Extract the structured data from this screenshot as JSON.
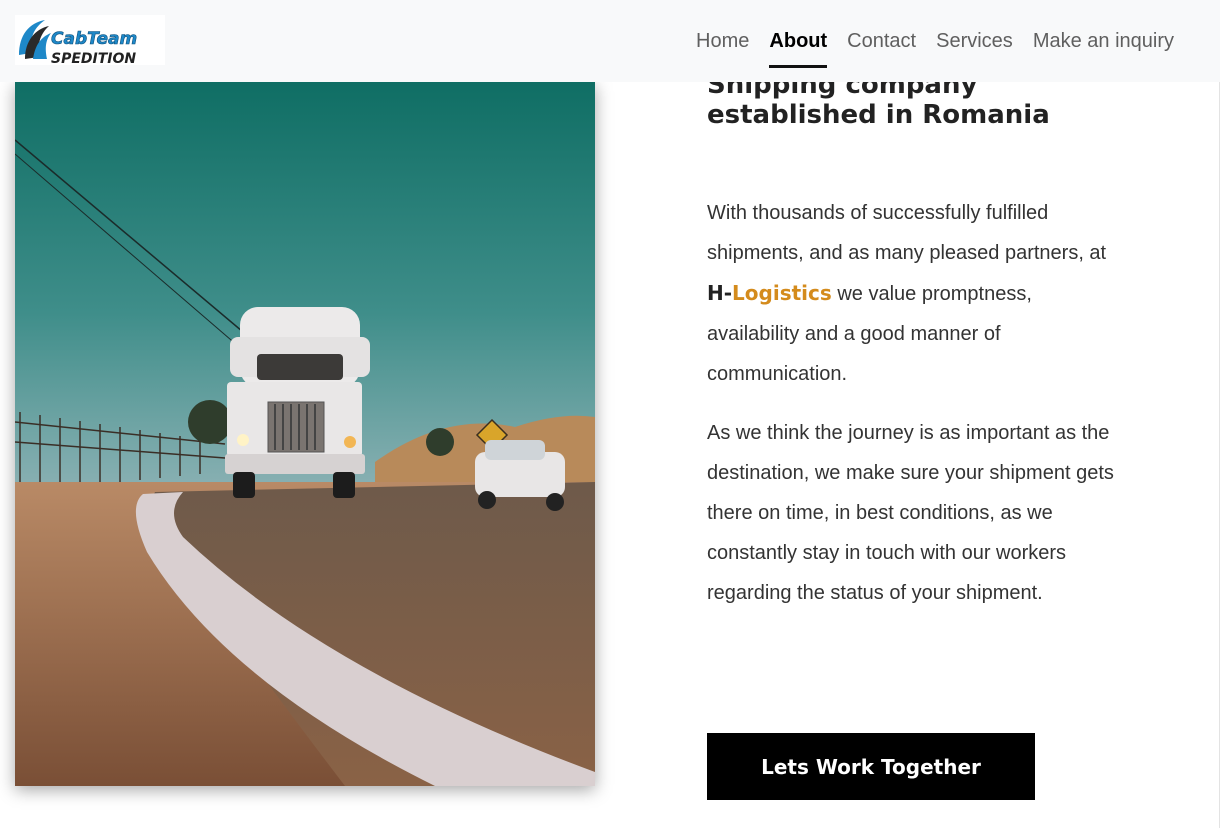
{
  "header": {
    "logo_text_line1": "CabTeam",
    "logo_text_line2": "SPEDITION",
    "nav": [
      {
        "label": "Home",
        "active": false
      },
      {
        "label": "About",
        "active": true
      },
      {
        "label": "Contact",
        "active": false
      },
      {
        "label": "Services",
        "active": false
      },
      {
        "label": "Make an inquiry",
        "active": false
      }
    ]
  },
  "hero": {
    "image_icon": "truck-on-road-photo"
  },
  "about": {
    "heading": "Shipping company established in Romania",
    "para1_before": "With thousands of successfully fulfilled shipments, and as many pleased partners, at ",
    "brand_prefix": "H-",
    "brand_accent": "Logistics",
    "para1_after": " we value promptness, availability and a good manner of communication.",
    "para2": "As we think the journey is as important as the destination, we make sure your shipment gets there on time, in best conditions, as we constantly stay in touch with our workers regarding the status of your shipment.",
    "cta_label": "Lets Work Together"
  },
  "colors": {
    "accent": "#d48b1c",
    "nav_bg": "#f8f9fa",
    "button_bg": "#000000"
  }
}
